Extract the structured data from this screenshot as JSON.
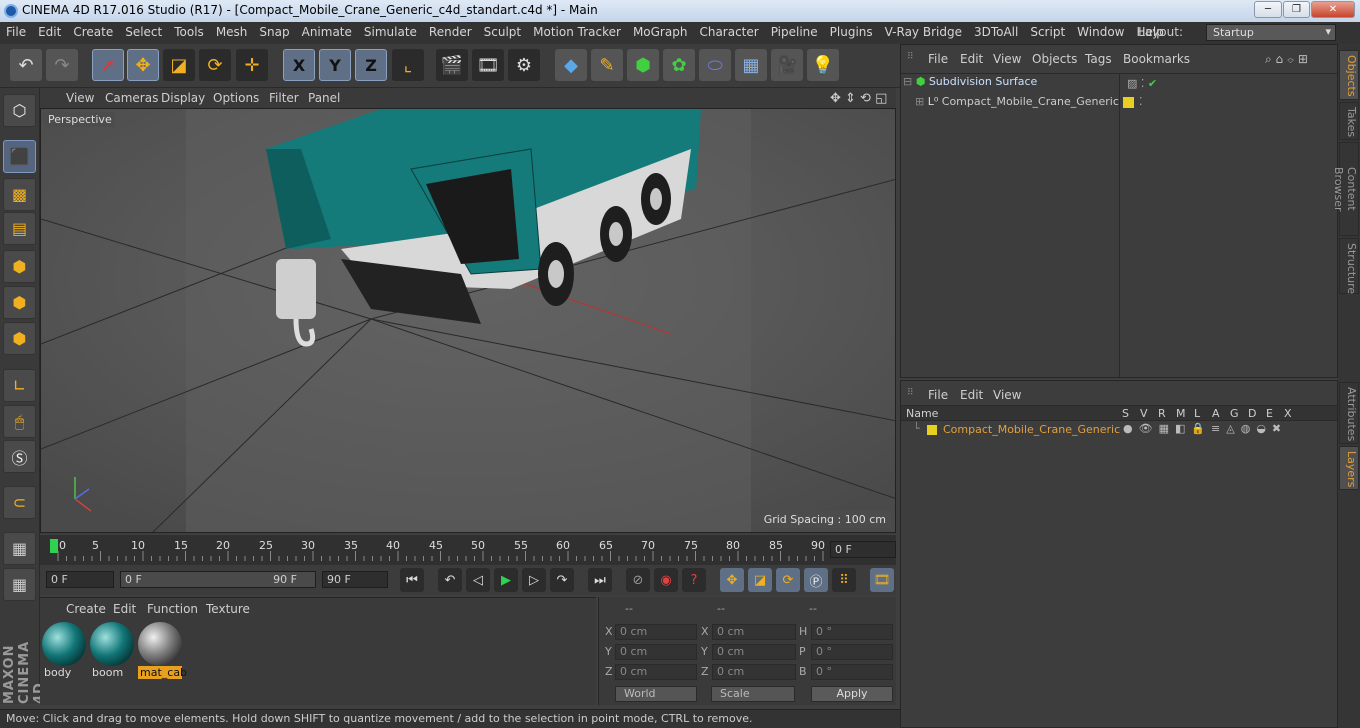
{
  "window": {
    "title": "CINEMA 4D R17.016 Studio (R17) - [Compact_Mobile_Crane_Generic_c4d_standart.c4d *] - Main",
    "min_label": "─",
    "max_label": "❐",
    "close_label": "✕"
  },
  "menu": [
    "File",
    "Edit",
    "Create",
    "Select",
    "Tools",
    "Mesh",
    "Snap",
    "Animate",
    "Simulate",
    "Render",
    "Sculpt",
    "Motion Tracker",
    "MoGraph",
    "Character",
    "Pipeline",
    "Plugins",
    "V-Ray Bridge",
    "3DToAll",
    "Script",
    "Window",
    "Help"
  ],
  "layout": {
    "label": "Layout:",
    "value": "Startup"
  },
  "toolbar": {
    "x_label": "X",
    "y_label": "Y",
    "z_label": "Z"
  },
  "viewport": {
    "menu": [
      "View",
      "Cameras",
      "Display",
      "Options",
      "Filter",
      "Panel"
    ],
    "camera_label": "Perspective",
    "grid_spacing": "Grid Spacing : 100 cm"
  },
  "timeline": {
    "ticks": [
      "0",
      "5",
      "10",
      "15",
      "20",
      "25",
      "30",
      "35",
      "40",
      "45",
      "50",
      "55",
      "60",
      "65",
      "70",
      "75",
      "80",
      "85",
      "90"
    ],
    "current_frame_field": "0 F",
    "start_field": "0 F",
    "range_start": "0 F",
    "range_end": "90 F",
    "end_field": "90 F"
  },
  "material_manager": {
    "menu": [
      "Create",
      "Edit",
      "Function",
      "Texture"
    ],
    "materials": [
      {
        "name": "body",
        "selected": false
      },
      {
        "name": "boom",
        "selected": false
      },
      {
        "name": "mat_cab",
        "selected": true
      }
    ]
  },
  "coordinates": {
    "headers": [
      "--",
      "--",
      "--"
    ],
    "rows": [
      {
        "a_label": "X",
        "a_val": "0 cm",
        "b_label": "X",
        "b_val": "0 cm",
        "c_label": "H",
        "c_val": "0 °"
      },
      {
        "a_label": "Y",
        "a_val": "0 cm",
        "b_label": "Y",
        "b_val": "0 cm",
        "c_label": "P",
        "c_val": "0 °"
      },
      {
        "a_label": "Z",
        "a_val": "0 cm",
        "b_label": "Z",
        "b_val": "0 cm",
        "c_label": "B",
        "c_val": "0 °"
      }
    ],
    "mode": "World",
    "size": "Scale",
    "apply": "Apply"
  },
  "object_manager": {
    "menu": [
      "File",
      "Edit",
      "View",
      "Objects",
      "Tags",
      "Bookmarks"
    ],
    "objects": [
      {
        "name": "Subdivision Surface"
      },
      {
        "name": "Compact_Mobile_Crane_Generic"
      }
    ]
  },
  "layer_manager": {
    "menu": [
      "File",
      "Edit",
      "View"
    ],
    "columns": [
      "Name",
      "S",
      "V",
      "R",
      "M",
      "L",
      "A",
      "G",
      "D",
      "E",
      "X"
    ],
    "layers": [
      {
        "name": "Compact_Mobile_Crane_Generic",
        "color": "#e8d020"
      }
    ]
  },
  "side_tabs": [
    "Objects",
    "Takes",
    "Content Browser",
    "Structure",
    "Attributes",
    "Layers"
  ],
  "status": "Move: Click and drag to move elements. Hold down SHIFT to quantize movement / add to the selection in point mode, CTRL to remove.",
  "branding": "MAXON CINEMA 4D",
  "colors": {
    "accent": "#e0a040",
    "crane": "#147a7a"
  }
}
